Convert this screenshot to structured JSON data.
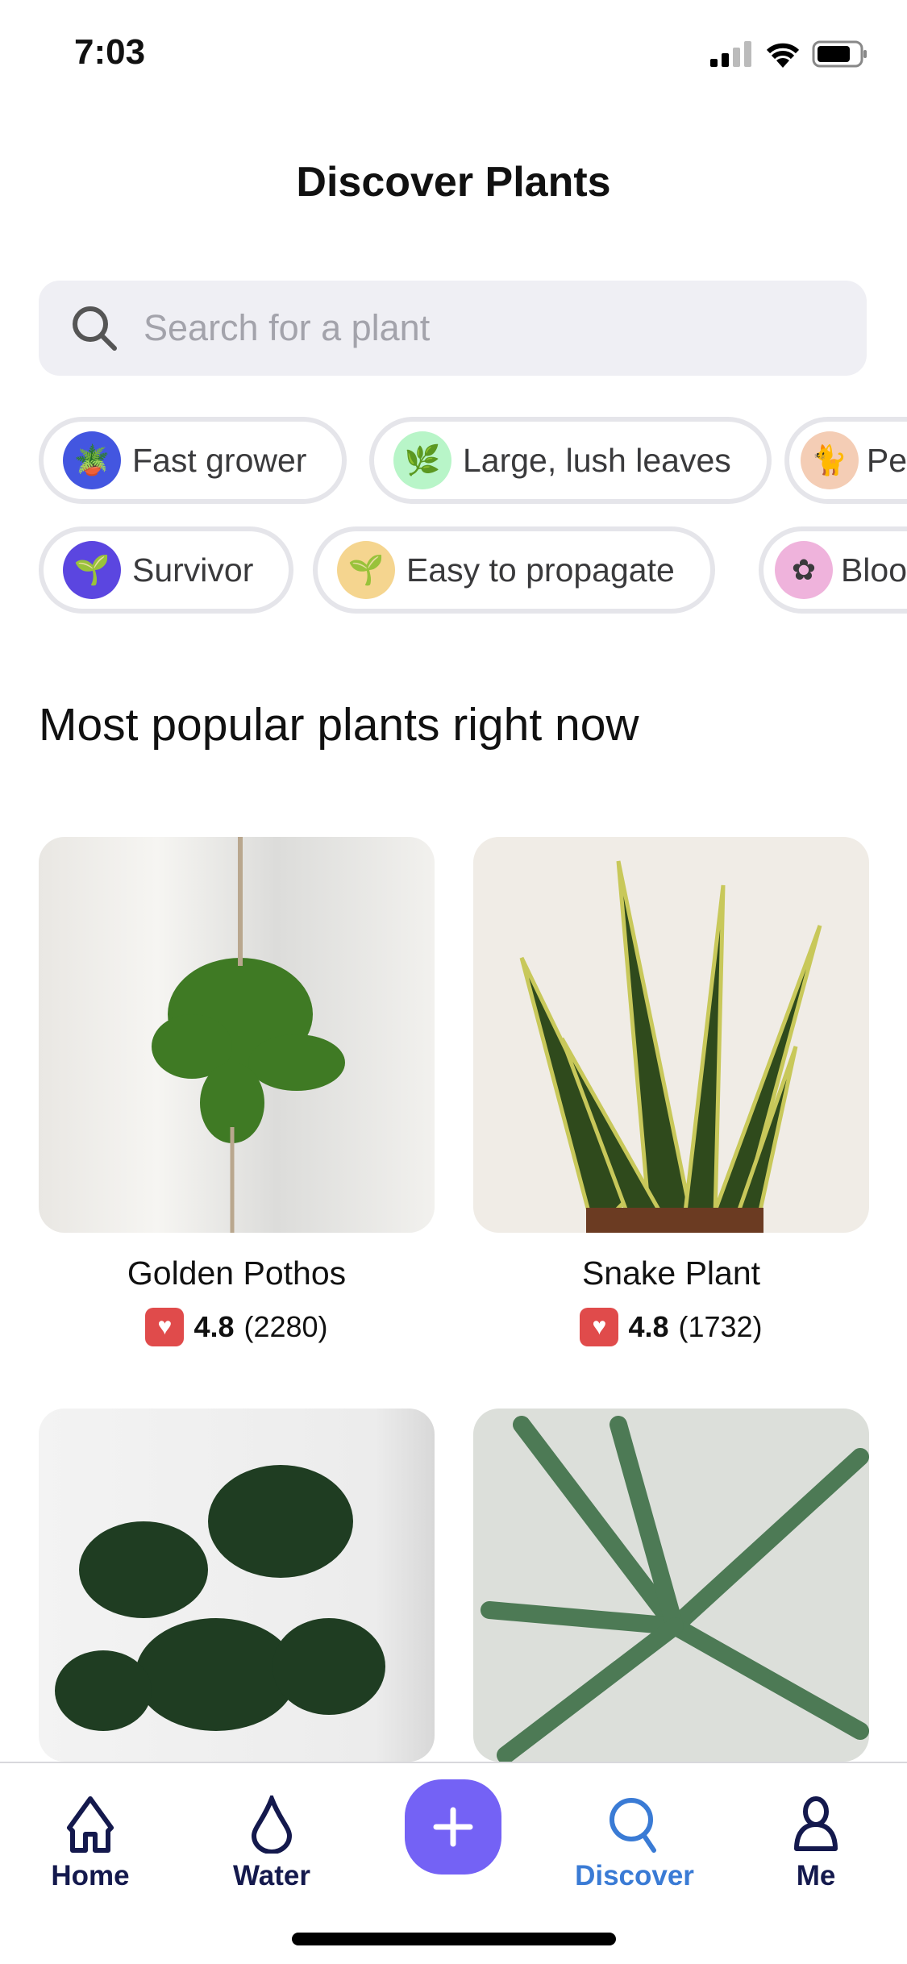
{
  "status": {
    "time": "7:03"
  },
  "header": {
    "title": "Discover Plants"
  },
  "search": {
    "placeholder": "Search for a plant"
  },
  "chips_row1": [
    {
      "label": "Fast grower",
      "color": "#4356e0"
    },
    {
      "label": "Large, lush leaves",
      "color": "#b8f5c8"
    },
    {
      "label": "Pe",
      "color": "#f4cdb5"
    }
  ],
  "chips_row2": [
    {
      "label": "Survivor",
      "color": "#5b46e0"
    },
    {
      "label": "Easy to propagate",
      "color": "#f5d58f"
    },
    {
      "label": "Bloo",
      "color": "#efb3dc"
    }
  ],
  "section": {
    "title": "Most popular plants right now"
  },
  "plants": [
    {
      "name": "Golden Pothos",
      "rating": "4.8",
      "count": "(2280)"
    },
    {
      "name": "Snake Plant",
      "rating": "4.8",
      "count": "(1732)"
    }
  ],
  "tabs": [
    {
      "label": "Home",
      "icon": "home-icon"
    },
    {
      "label": "Water",
      "icon": "drop-icon"
    },
    {
      "label": "Discover",
      "icon": "search-icon",
      "active": true,
      "color": "#3a7bd5"
    },
    {
      "label": "Me",
      "icon": "person-icon"
    }
  ],
  "colors": {
    "accent": "#7462f5",
    "tab_active": "#3a7bd5",
    "tab_inactive": "#14194d",
    "heart": "#e04b4b"
  }
}
